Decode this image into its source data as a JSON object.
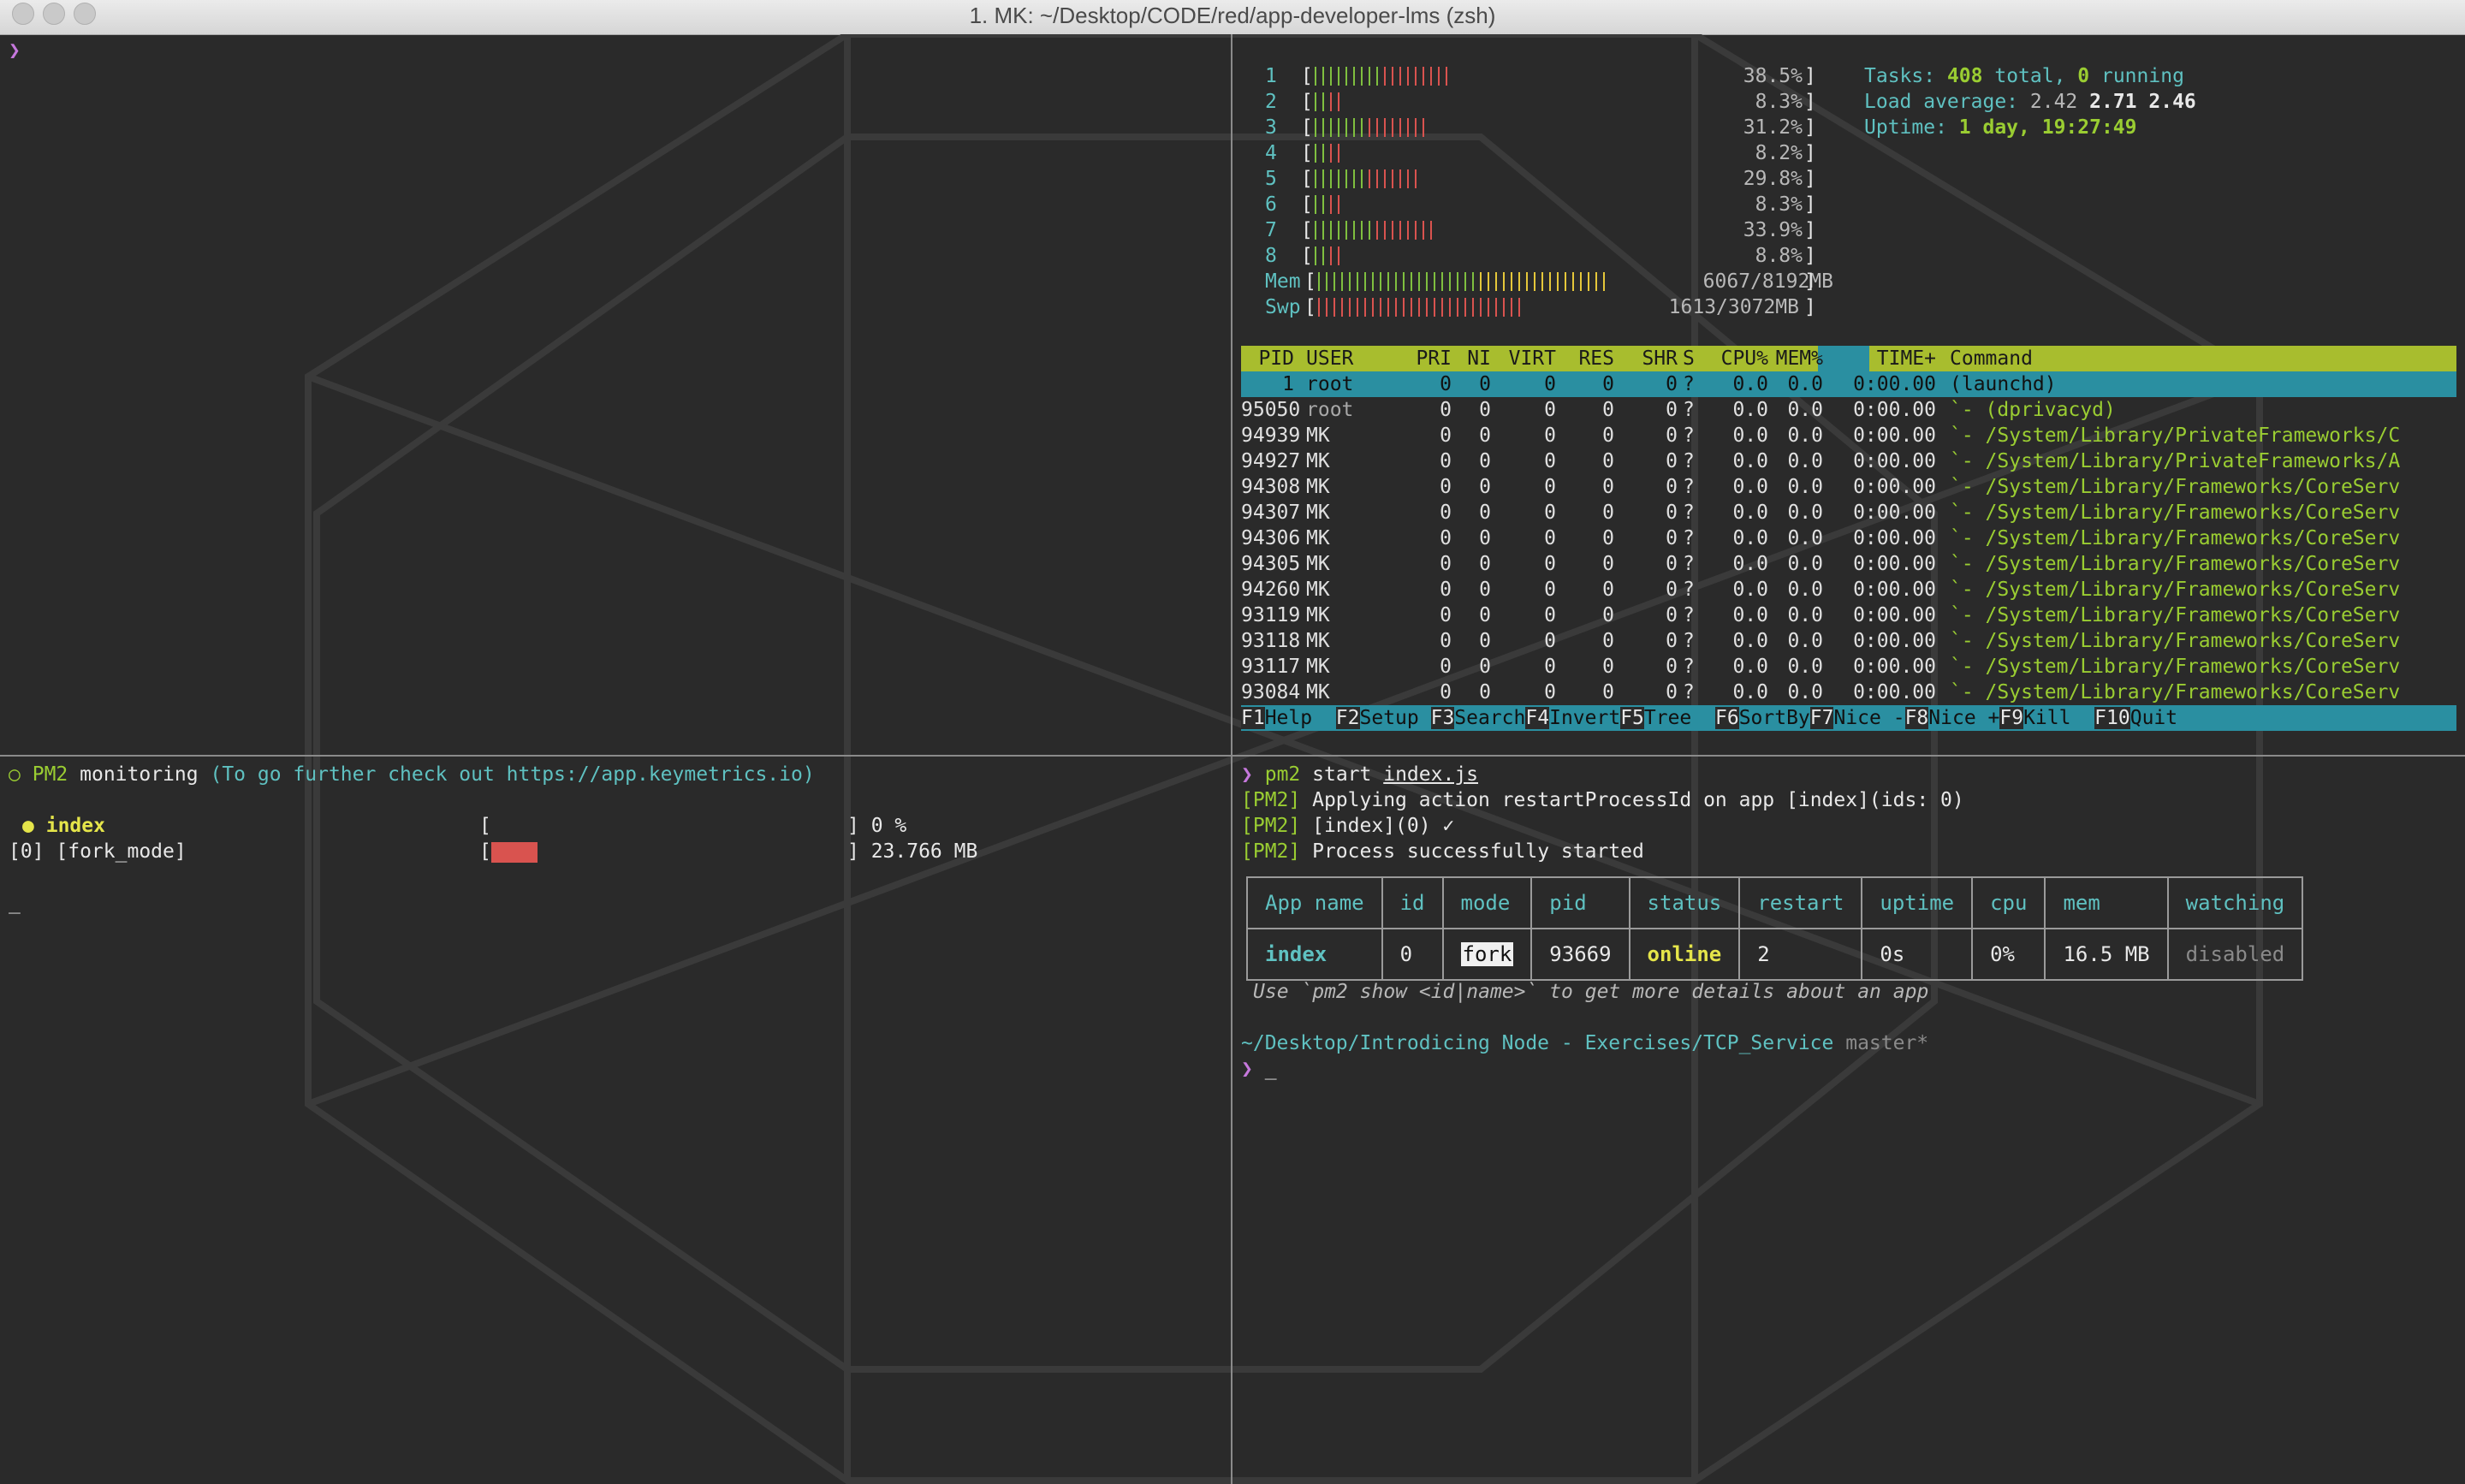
{
  "window": {
    "title": "1. MK: ~/Desktop/CODE/red/app-developer-lms (zsh)"
  },
  "prompt_symbol": "❯",
  "htop": {
    "cpus": [
      {
        "n": "1",
        "pct": "38.5%",
        "value": 38.5
      },
      {
        "n": "2",
        "pct": "8.3%",
        "value": 8.3
      },
      {
        "n": "3",
        "pct": "31.2%",
        "value": 31.2
      },
      {
        "n": "4",
        "pct": "8.2%",
        "value": 8.2
      },
      {
        "n": "5",
        "pct": "29.8%",
        "value": 29.8
      },
      {
        "n": "6",
        "pct": "8.3%",
        "value": 8.3
      },
      {
        "n": "7",
        "pct": "33.9%",
        "value": 33.9
      },
      {
        "n": "8",
        "pct": "8.8%",
        "value": 8.8
      }
    ],
    "mem": {
      "label": "Mem",
      "value": "6067/8192MB",
      "fraction": 0.74
    },
    "swp": {
      "label": "Swp",
      "value": "1613/3072MB",
      "fraction": 0.52
    },
    "tasks_label": "Tasks:",
    "tasks_total": "408",
    "tasks_total_suffix": " total, ",
    "tasks_running": "0",
    "tasks_running_suffix": " running",
    "load_label": "Load average:",
    "load1": "2.42",
    "load5": "2.71",
    "load15": "2.46",
    "uptime_label": "Uptime:",
    "uptime": "1 day, 19:27:49",
    "columns": [
      "PID",
      "USER",
      "PRI",
      "NI",
      "VIRT",
      "RES",
      "SHR",
      "S",
      "CPU%",
      "MEM%",
      "TIME+",
      "Command"
    ],
    "processes": [
      {
        "pid": "1",
        "user": "root",
        "pri": "0",
        "ni": "0",
        "virt": "0",
        "res": "0",
        "shr": "0",
        "s": "?",
        "cpu": "0.0",
        "mem": "0.0",
        "time": "0:00.00",
        "cmd": "(launchd)"
      },
      {
        "pid": "95050",
        "user": "root",
        "pri": "0",
        "ni": "0",
        "virt": "0",
        "res": "0",
        "shr": "0",
        "s": "?",
        "cpu": "0.0",
        "mem": "0.0",
        "time": "0:00.00",
        "cmd": "`- (dprivacyd)"
      },
      {
        "pid": "94939",
        "user": "MK",
        "pri": "0",
        "ni": "0",
        "virt": "0",
        "res": "0",
        "shr": "0",
        "s": "?",
        "cpu": "0.0",
        "mem": "0.0",
        "time": "0:00.00",
        "cmd": "`- /System/Library/PrivateFrameworks/C"
      },
      {
        "pid": "94927",
        "user": "MK",
        "pri": "0",
        "ni": "0",
        "virt": "0",
        "res": "0",
        "shr": "0",
        "s": "?",
        "cpu": "0.0",
        "mem": "0.0",
        "time": "0:00.00",
        "cmd": "`- /System/Library/PrivateFrameworks/A"
      },
      {
        "pid": "94308",
        "user": "MK",
        "pri": "0",
        "ni": "0",
        "virt": "0",
        "res": "0",
        "shr": "0",
        "s": "?",
        "cpu": "0.0",
        "mem": "0.0",
        "time": "0:00.00",
        "cmd": "`- /System/Library/Frameworks/CoreServ"
      },
      {
        "pid": "94307",
        "user": "MK",
        "pri": "0",
        "ni": "0",
        "virt": "0",
        "res": "0",
        "shr": "0",
        "s": "?",
        "cpu": "0.0",
        "mem": "0.0",
        "time": "0:00.00",
        "cmd": "`- /System/Library/Frameworks/CoreServ"
      },
      {
        "pid": "94306",
        "user": "MK",
        "pri": "0",
        "ni": "0",
        "virt": "0",
        "res": "0",
        "shr": "0",
        "s": "?",
        "cpu": "0.0",
        "mem": "0.0",
        "time": "0:00.00",
        "cmd": "`- /System/Library/Frameworks/CoreServ"
      },
      {
        "pid": "94305",
        "user": "MK",
        "pri": "0",
        "ni": "0",
        "virt": "0",
        "res": "0",
        "shr": "0",
        "s": "?",
        "cpu": "0.0",
        "mem": "0.0",
        "time": "0:00.00",
        "cmd": "`- /System/Library/Frameworks/CoreServ"
      },
      {
        "pid": "94260",
        "user": "MK",
        "pri": "0",
        "ni": "0",
        "virt": "0",
        "res": "0",
        "shr": "0",
        "s": "?",
        "cpu": "0.0",
        "mem": "0.0",
        "time": "0:00.00",
        "cmd": "`- /System/Library/Frameworks/CoreServ"
      },
      {
        "pid": "93119",
        "user": "MK",
        "pri": "0",
        "ni": "0",
        "virt": "0",
        "res": "0",
        "shr": "0",
        "s": "?",
        "cpu": "0.0",
        "mem": "0.0",
        "time": "0:00.00",
        "cmd": "`- /System/Library/Frameworks/CoreServ"
      },
      {
        "pid": "93118",
        "user": "MK",
        "pri": "0",
        "ni": "0",
        "virt": "0",
        "res": "0",
        "shr": "0",
        "s": "?",
        "cpu": "0.0",
        "mem": "0.0",
        "time": "0:00.00",
        "cmd": "`- /System/Library/Frameworks/CoreServ"
      },
      {
        "pid": "93117",
        "user": "MK",
        "pri": "0",
        "ni": "0",
        "virt": "0",
        "res": "0",
        "shr": "0",
        "s": "?",
        "cpu": "0.0",
        "mem": "0.0",
        "time": "0:00.00",
        "cmd": "`- /System/Library/Frameworks/CoreServ"
      },
      {
        "pid": "93084",
        "user": "MK",
        "pri": "0",
        "ni": "0",
        "virt": "0",
        "res": "0",
        "shr": "0",
        "s": "?",
        "cpu": "0.0",
        "mem": "0.0",
        "time": "0:00.00",
        "cmd": "`- /System/Library/Frameworks/CoreServ"
      }
    ],
    "fkeys": [
      {
        "key": "F1",
        "label": "Help  "
      },
      {
        "key": "F2",
        "label": "Setup "
      },
      {
        "key": "F3",
        "label": "Search"
      },
      {
        "key": "F4",
        "label": "Invert"
      },
      {
        "key": "F5",
        "label": "Tree  "
      },
      {
        "key": "F6",
        "label": "SortBy"
      },
      {
        "key": "F7",
        "label": "Nice -"
      },
      {
        "key": "F8",
        "label": "Nice +"
      },
      {
        "key": "F9",
        "label": "Kill  "
      },
      {
        "key": "F10",
        "label": "Quit  "
      }
    ]
  },
  "pm2monit": {
    "bullet": "○",
    "pm2": "PM2",
    "monitoring": "monitoring",
    "hint": "(To go further check out https://app.keymetrics.io)",
    "app_bullet": "●",
    "app_name": "index",
    "mode_line": "[0] [fork_mode]",
    "cpu": "] 0 %",
    "mem": "] 23.766 MB",
    "cursor": "_"
  },
  "shell": {
    "command_name": "pm2",
    "command_args": "start",
    "command_file": "index.js",
    "logs": [
      {
        "tag": "[PM2]",
        "text": "Applying action restartProcessId on app [index](ids: 0)"
      },
      {
        "tag": "[PM2]",
        "text": "[index](0) ✓"
      },
      {
        "tag": "[PM2]",
        "text": "Process successfully started"
      }
    ],
    "table": {
      "headers": [
        "App name",
        "id",
        "mode",
        "pid",
        "status",
        "restart",
        "uptime",
        "cpu",
        "mem",
        "watching"
      ],
      "row": {
        "name": "index",
        "id": "0",
        "mode": "fork",
        "pid": "93669",
        "status": "online",
        "restart": "2",
        "uptime": "0s",
        "cpu": "0%",
        "mem": "16.5 MB",
        "watching": "disabled"
      }
    },
    "hint": "Use `pm2 show <id|name>` to get more details about an app",
    "cwd": "~/Desktop/Introdicing Node - Exercises/TCP_Service",
    "branch": "master*",
    "cursor": "_"
  }
}
